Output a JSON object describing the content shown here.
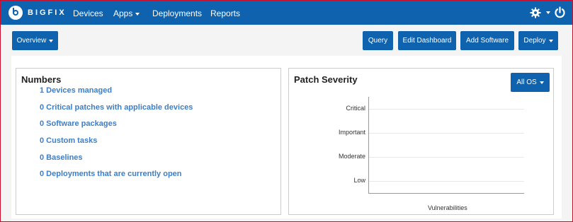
{
  "navbar": {
    "brand": "BIGFIX",
    "items": [
      {
        "label": "Devices",
        "dropdown": false
      },
      {
        "label": "Apps",
        "dropdown": true
      },
      {
        "label": "Deployments",
        "dropdown": false
      },
      {
        "label": "Reports",
        "dropdown": false
      }
    ],
    "icons": [
      "gear-icon",
      "power-icon"
    ],
    "color": "#0f62ad"
  },
  "toolbar": {
    "overview_label": "Overview",
    "query_label": "Query",
    "edit_dashboard_label": "Edit Dashboard",
    "add_software_label": "Add Software",
    "deploy_label": "Deploy"
  },
  "numbers_panel": {
    "title": "Numbers",
    "items": [
      "1 Devices managed",
      "0 Critical patches with applicable devices",
      "0 Software packages",
      "0 Custom tasks",
      "0 Baselines",
      "0 Deployments that are currently open"
    ],
    "link_color": "#3d7ec4"
  },
  "patch_panel": {
    "title": "Patch Severity",
    "filter_label": "All OS"
  },
  "chart_data": {
    "type": "bar",
    "orientation": "horizontal",
    "categories": [
      "Critical",
      "Important",
      "Moderate",
      "Low"
    ],
    "values": [
      0,
      0,
      0,
      0
    ],
    "title": "",
    "xlabel": "Vulnerabilities",
    "ylabel": "",
    "grid": true
  }
}
